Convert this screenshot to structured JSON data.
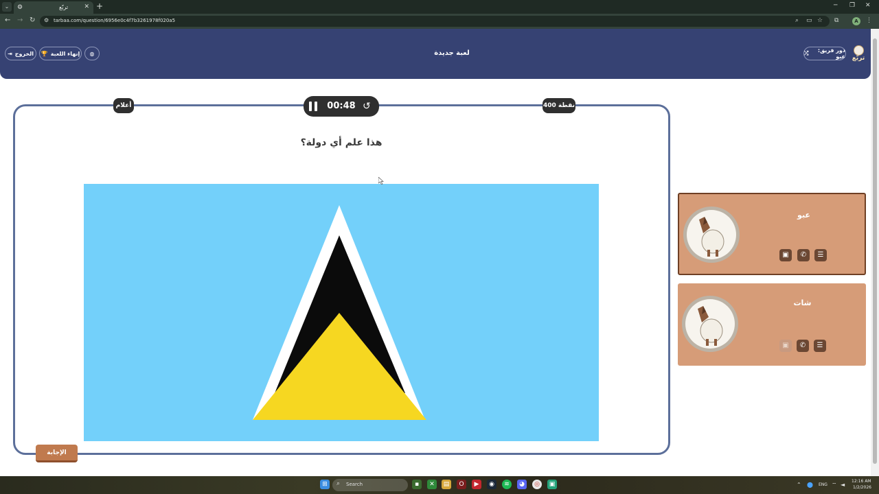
{
  "browser": {
    "tab_title": "تربّع",
    "url": "tarbaa.com/question/6956e0c4f7b3261978f020a5"
  },
  "header": {
    "title": "لعبة جديدة",
    "exit_label": "الخروج",
    "end_game_label": "إنهاء اللعبة",
    "turn_label": "دور فريق: عبو",
    "logo_text": "تربّع"
  },
  "question": {
    "category": "أعلام",
    "points": "400 نقطة",
    "timer": "00:48",
    "text": "هذا علم أي دولة؟",
    "answer_label": "الإجابة"
  },
  "teams": [
    {
      "name": "عبو"
    },
    {
      "name": "شات"
    }
  ],
  "taskbar": {
    "search_placeholder": "Search",
    "language": "ENG",
    "time": "12:16 AM",
    "date": "1/2/2026"
  },
  "colors": {
    "header_bg": "#364273",
    "card_border": "#5c6f9a",
    "team_card_bg": "#d69c78",
    "answer_button": "#c07a4e",
    "flag_blue": "#73d0fa",
    "flag_yellow": "#f6d721"
  }
}
